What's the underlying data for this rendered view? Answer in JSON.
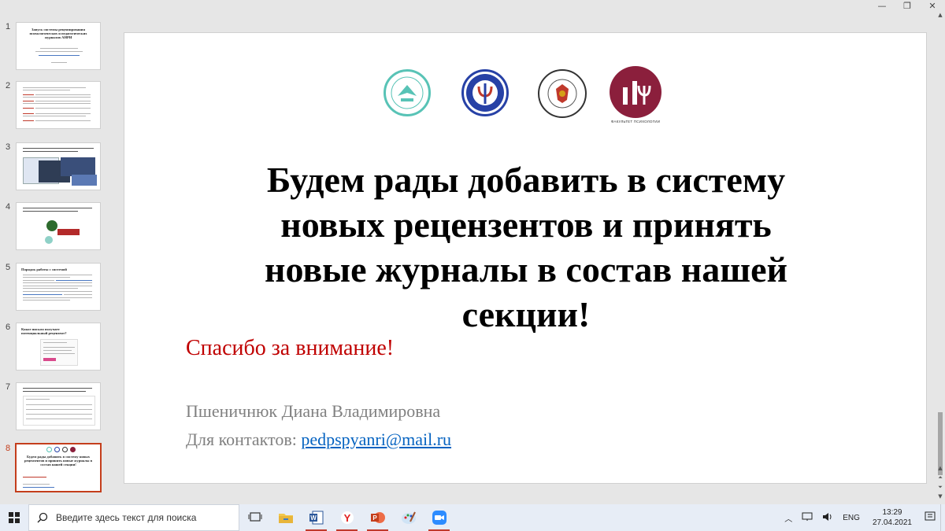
{
  "thumbnails": [
    {
      "num": "1",
      "title": "Запуск системы рецензирования психологических и педагогических журналов АНРИ"
    },
    {
      "num": "2",
      "title": ""
    },
    {
      "num": "3",
      "title": ""
    },
    {
      "num": "4",
      "title": ""
    },
    {
      "num": "5",
      "title": "Порядок работы с системой"
    },
    {
      "num": "6",
      "title": "Какое письмо получает потенциальный рецензент?"
    },
    {
      "num": "7",
      "title": ""
    },
    {
      "num": "8",
      "title": "Будем рады добавить в систему новых рецензентов и принять новые журналы в состав нашей секции!"
    }
  ],
  "slide": {
    "headline_lines": [
      "Будем рады добавить в систему",
      "новых рецензентов и принять",
      "новые журналы в состав нашей",
      "секции!"
    ],
    "thanks": "Спасибо за внимание!",
    "author": "Пшеничнюк Диана Владимировна",
    "contact_label": "Для контактов: ",
    "contact_email": "pedpspyanri@mail.ru",
    "logos": [
      "anri-logo",
      "rpo-logo",
      "rao-logo",
      "psychology-faculty-logo"
    ]
  },
  "taskbar": {
    "search_placeholder": "Введите здесь текст для поиска",
    "apps": [
      "task-view-icon",
      "file-explorer-icon",
      "word-icon",
      "yandex-browser-icon",
      "powerpoint-icon",
      "paint-icon",
      "zoom-icon"
    ],
    "language": "ENG",
    "time": "13:29",
    "date": "27.04.2021"
  },
  "colors": {
    "accent_red": "#c43e1c",
    "thanks_red": "#c00000",
    "link_blue": "#0563c1",
    "gray_text": "#808080",
    "taskbar_bg": "#e7edf6"
  }
}
